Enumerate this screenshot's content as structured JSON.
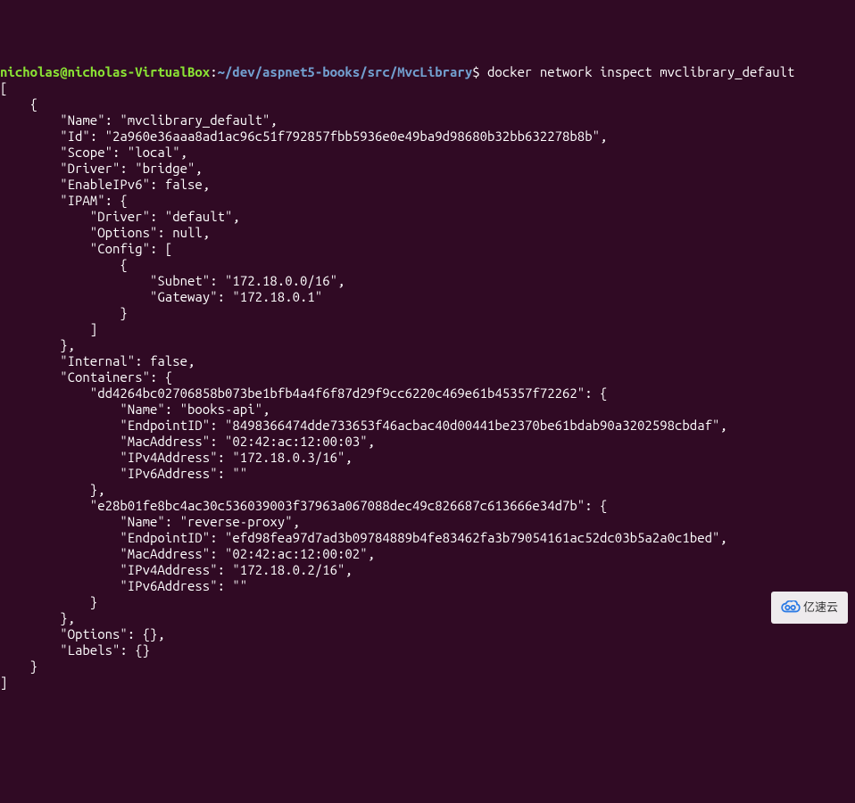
{
  "prompt": {
    "user_host": "nicholas@nicholas-VirtualBox",
    "colon": ":",
    "tilde": "~",
    "path": "/dev/aspnet5-books/src/MvcLibrary",
    "dollar": "$"
  },
  "command": "docker network inspect mvclibrary_default",
  "lines": {
    "l01": "[",
    "l02": "    {",
    "l03": "        \"Name\": \"mvclibrary_default\",",
    "l04": "        \"Id\": \"2a960e36aaa8ad1ac96c51f792857fbb5936e0e49ba9d98680b32bb632278b8b\",",
    "l05": "        \"Scope\": \"local\",",
    "l06": "        \"Driver\": \"bridge\",",
    "l07": "        \"EnableIPv6\": false,",
    "l08": "        \"IPAM\": {",
    "l09": "            \"Driver\": \"default\",",
    "l10": "            \"Options\": null,",
    "l11": "            \"Config\": [",
    "l12": "                {",
    "l13": "                    \"Subnet\": \"172.18.0.0/16\",",
    "l14": "                    \"Gateway\": \"172.18.0.1\"",
    "l15": "                }",
    "l16": "            ]",
    "l17": "        },",
    "l18": "        \"Internal\": false,",
    "l19": "        \"Containers\": {",
    "l20": "            \"dd4264bc02706858b073be1bfb4a4f6f87d29f9cc6220c469e61b45357f72262\": {",
    "l21": "                \"Name\": \"books-api\",",
    "l22": "                \"EndpointID\": \"8498366474dde733653f46acbac40d00441be2370be61bdab90a3202598cbdaf\",",
    "l23": "                \"MacAddress\": \"02:42:ac:12:00:03\",",
    "l24": "                \"IPv4Address\": \"172.18.0.3/16\",",
    "l25": "                \"IPv6Address\": \"\"",
    "l26": "            },",
    "l27": "            \"e28b01fe8bc4ac30c536039003f37963a067088dec49c826687c613666e34d7b\": {",
    "l28": "                \"Name\": \"reverse-proxy\",",
    "l29": "                \"EndpointID\": \"efd98fea97d7ad3b09784889b4fe83462fa3b79054161ac52dc03b5a2a0c1bed\",",
    "l30": "                \"MacAddress\": \"02:42:ac:12:00:02\",",
    "l31": "                \"IPv4Address\": \"172.18.0.2/16\",",
    "l32": "                \"IPv6Address\": \"\"",
    "l33": "            }",
    "l34": "        },",
    "l35": "        \"Options\": {},",
    "l36": "        \"Labels\": {}",
    "l37": "    }",
    "l38": "]"
  },
  "watermark": {
    "text": "亿速云"
  }
}
